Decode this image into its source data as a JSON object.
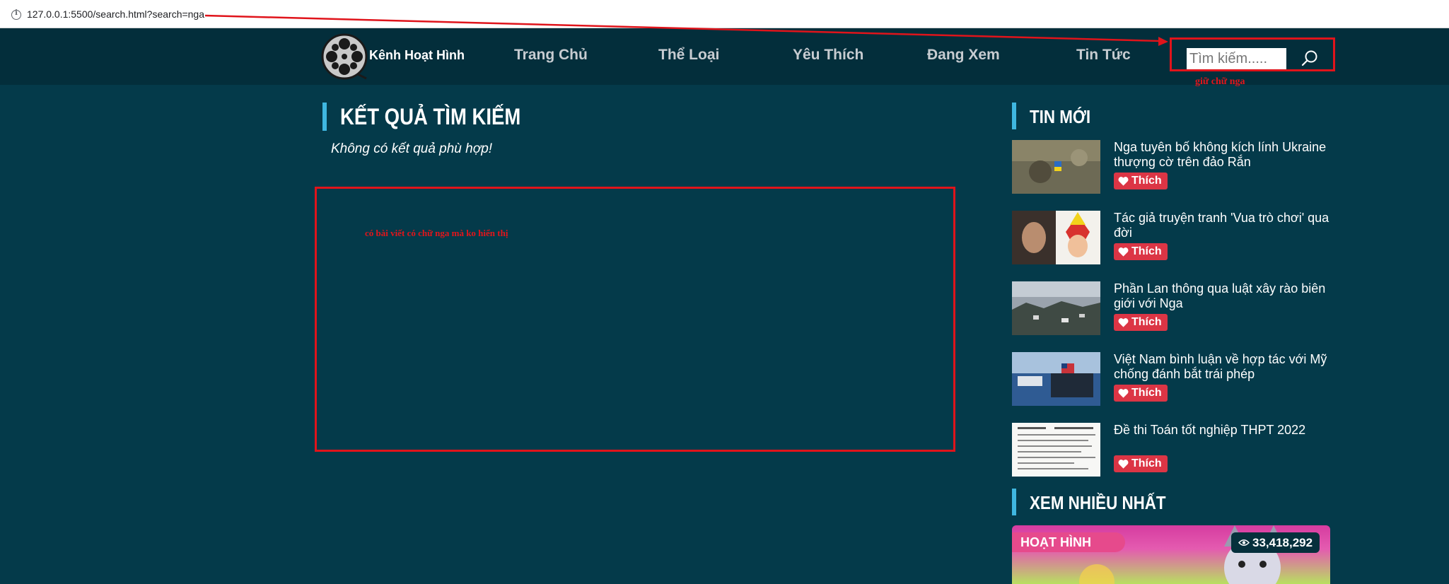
{
  "browser": {
    "url": "127.0.0.1:5500/search.html?search=nga"
  },
  "header": {
    "logo_text": "Kênh Hoạt Hình",
    "nav": [
      {
        "label": "Trang Chủ"
      },
      {
        "label": "Thể Loại"
      },
      {
        "label": "Yêu Thích"
      },
      {
        "label": "Đang Xem"
      },
      {
        "label": "Tin Tức"
      }
    ],
    "search": {
      "placeholder": "Tìm kiếm.....",
      "value": ""
    }
  },
  "annotations": {
    "keep_text": "giữ chữ nga",
    "missing_posts": "có bài viết có chữ nga mà ko hiển thị"
  },
  "results": {
    "title": "KẾT QUẢ TÌM KIẾM",
    "empty_message": "Không có kết quả phù hợp!"
  },
  "sidebar": {
    "news_title": "TIN MỚI",
    "news": [
      {
        "title": "Nga tuyên bố không kích lính Ukraine thượng cờ trên đảo Rắn",
        "like": "Thích"
      },
      {
        "title": "Tác giả truyện tranh 'Vua trò chơi' qua đời",
        "like": "Thích"
      },
      {
        "title": "Phần Lan thông qua luật xây rào biên giới với Nga",
        "like": "Thích"
      },
      {
        "title": "Việt Nam bình luận về hợp tác với Mỹ chống đánh bắt trái phép",
        "like": "Thích"
      },
      {
        "title": "Đề thi Toán tốt nghiệp THPT 2022",
        "like": "Thích"
      }
    ],
    "most_viewed_title": "XEM NHIỀU NHẤT",
    "most_viewed": {
      "tag": "HOẠT HÌNH",
      "views": "33,418,292"
    }
  },
  "colors": {
    "page_bg": "#043a4a",
    "header_bg": "#032e3b",
    "accent_bar": "#3fb7e0",
    "like_red": "#dc3545",
    "annotation_red": "#e0141b"
  }
}
